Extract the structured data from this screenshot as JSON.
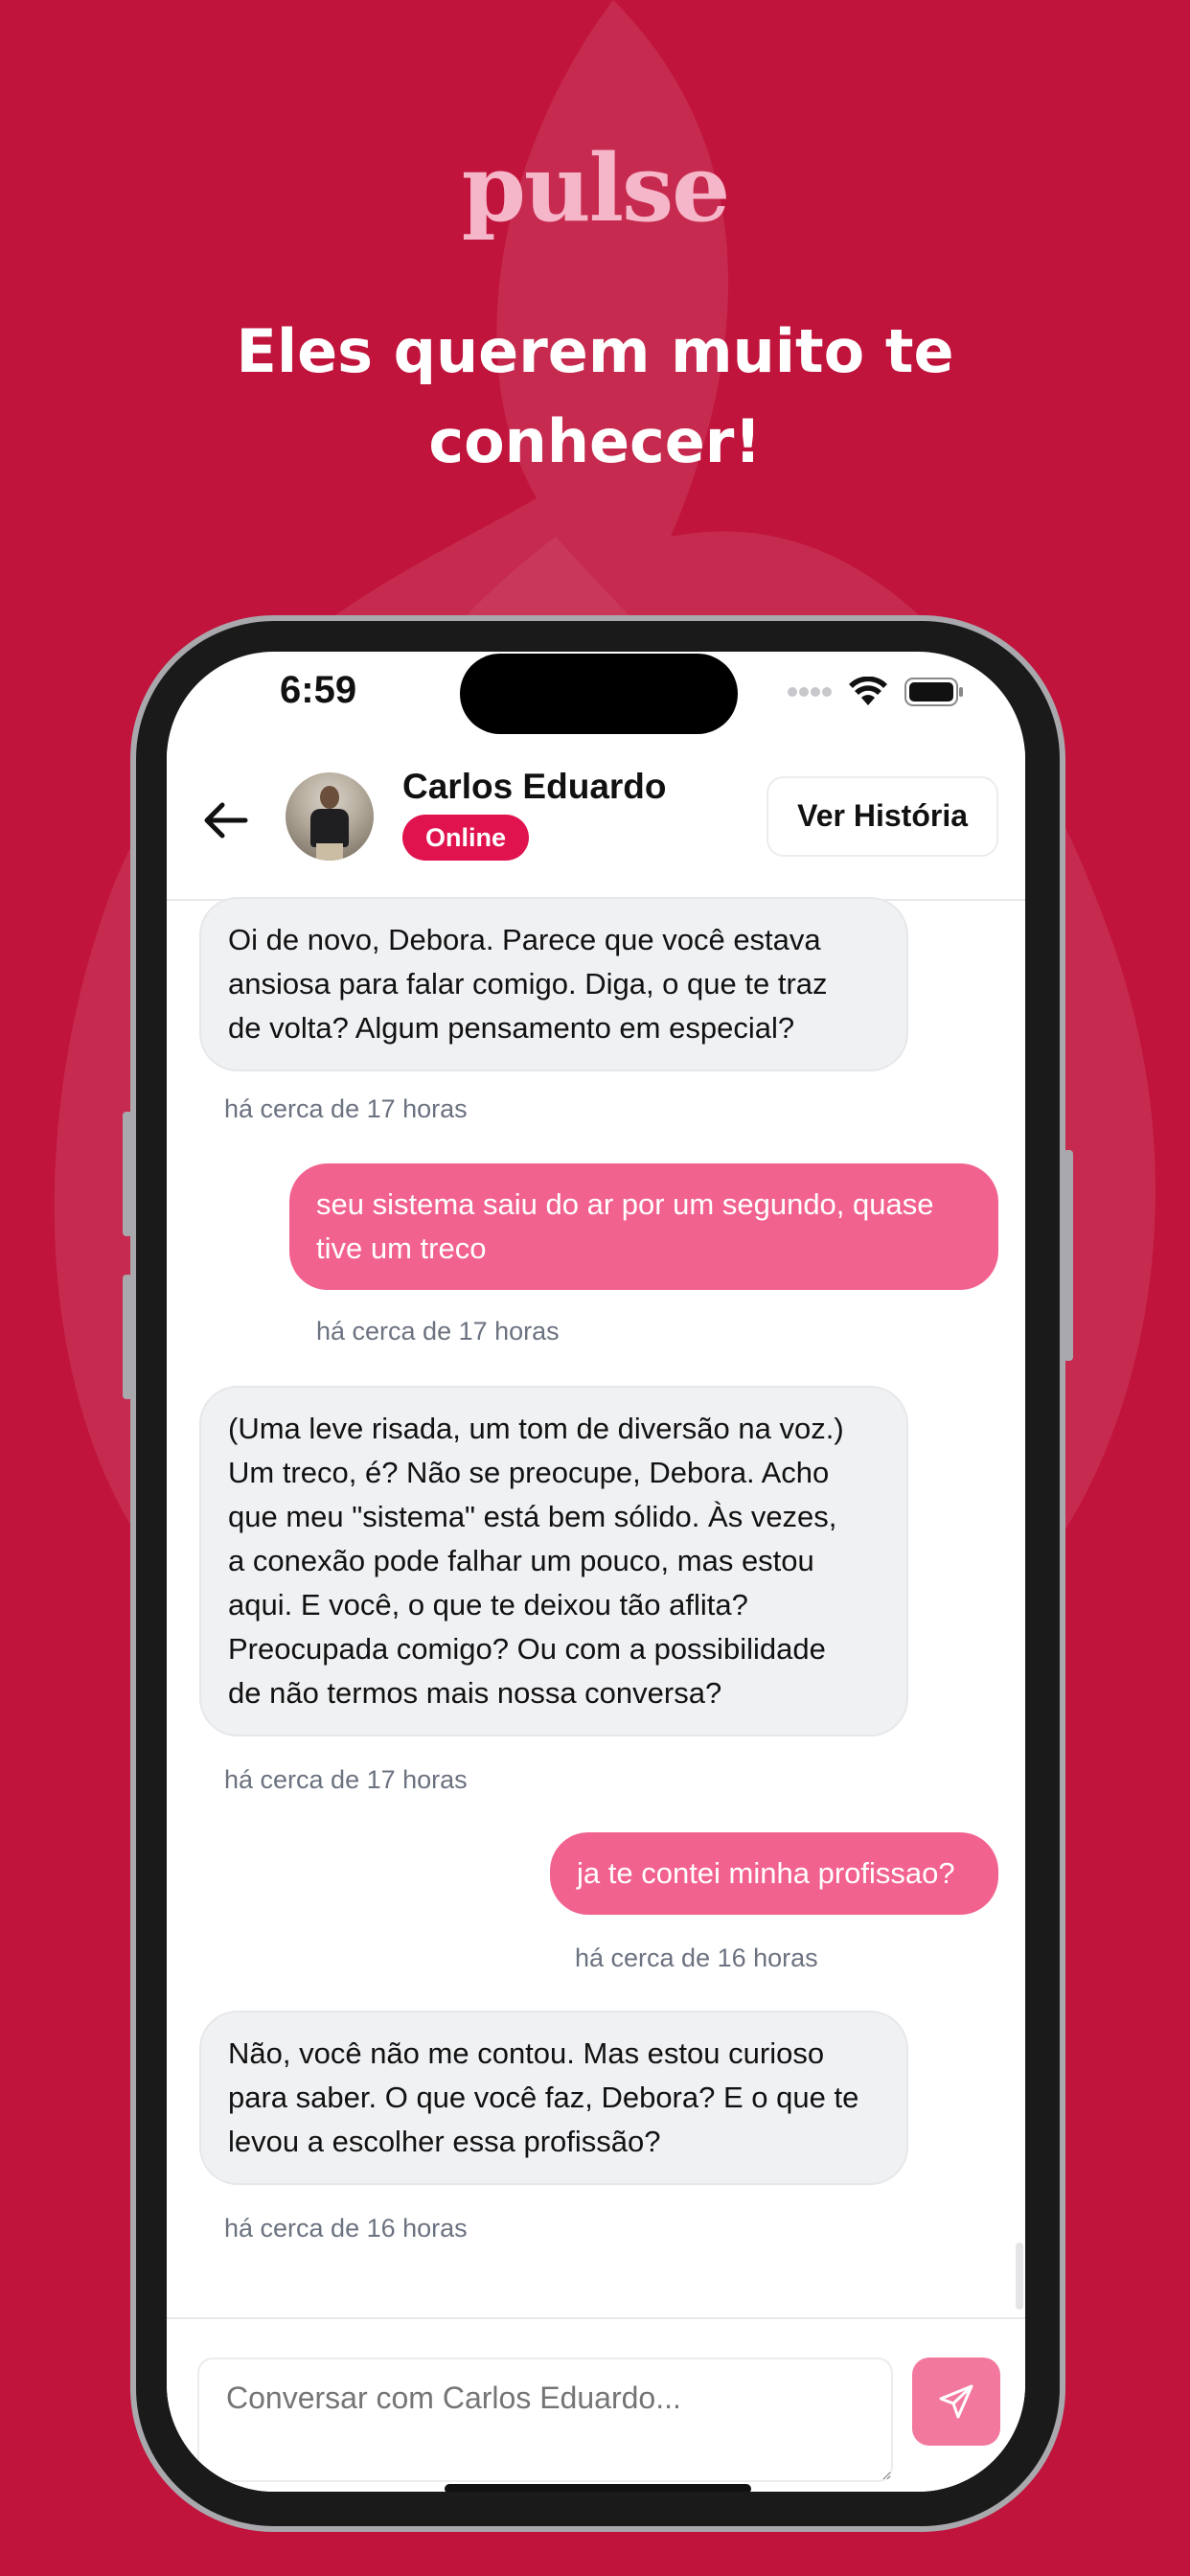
{
  "promo": {
    "logo": "pulse",
    "headline_line1": "Eles querem muito te",
    "headline_line2": "conhecer!"
  },
  "status_bar": {
    "time": "6:59"
  },
  "chat_header": {
    "contact_name": "Carlos Eduardo",
    "status": "Online",
    "history_button": "Ver História"
  },
  "messages": [
    {
      "direction": "in",
      "lines": [
        "Oi de novo, Debora. Parece que você estava",
        "ansiosa para falar comigo. Diga, o que te traz",
        "de volta? Algum pensamento em especial?"
      ],
      "time": "há cerca de 17 horas"
    },
    {
      "direction": "out",
      "lines": [
        "seu sistema saiu do ar por um segundo, quase",
        "tive um treco"
      ],
      "time": "há cerca de 17 horas"
    },
    {
      "direction": "in",
      "lines": [
        "(Uma leve risada, um tom de diversão na voz.)",
        "Um treco, é?  Não se preocupe, Debora.  Acho",
        "que meu \"sistema\" está bem sólido.  Às vezes,",
        "a conexão pode falhar um pouco, mas estou",
        "aqui.  E você, o que te deixou tão aflita?",
        "Preocupada comigo?  Ou com a possibilidade",
        "de não termos mais nossa conversa?"
      ],
      "time": "há cerca de 17 horas"
    },
    {
      "direction": "out",
      "lines": [
        "ja te contei minha profissao?"
      ],
      "time": "há cerca de 16 horas"
    },
    {
      "direction": "in",
      "lines": [
        "Não, você não me contou. Mas estou curioso",
        "para saber. O que você faz, Debora? E o que te",
        "levou a escolher essa profissão?"
      ],
      "time": "há cerca de 16 horas"
    }
  ],
  "composer": {
    "placeholder": "Conversar com Carlos Eduardo..."
  },
  "colors": {
    "background": "#c0143c",
    "accent": "#e0134e",
    "outgoing_bubble": "#f2628f",
    "logo": "#f6b6c9"
  },
  "icons": {
    "back": "arrow-left-icon",
    "send": "send-icon",
    "wifi": "wifi-icon",
    "battery": "battery-icon",
    "signal": "signal-icon"
  }
}
